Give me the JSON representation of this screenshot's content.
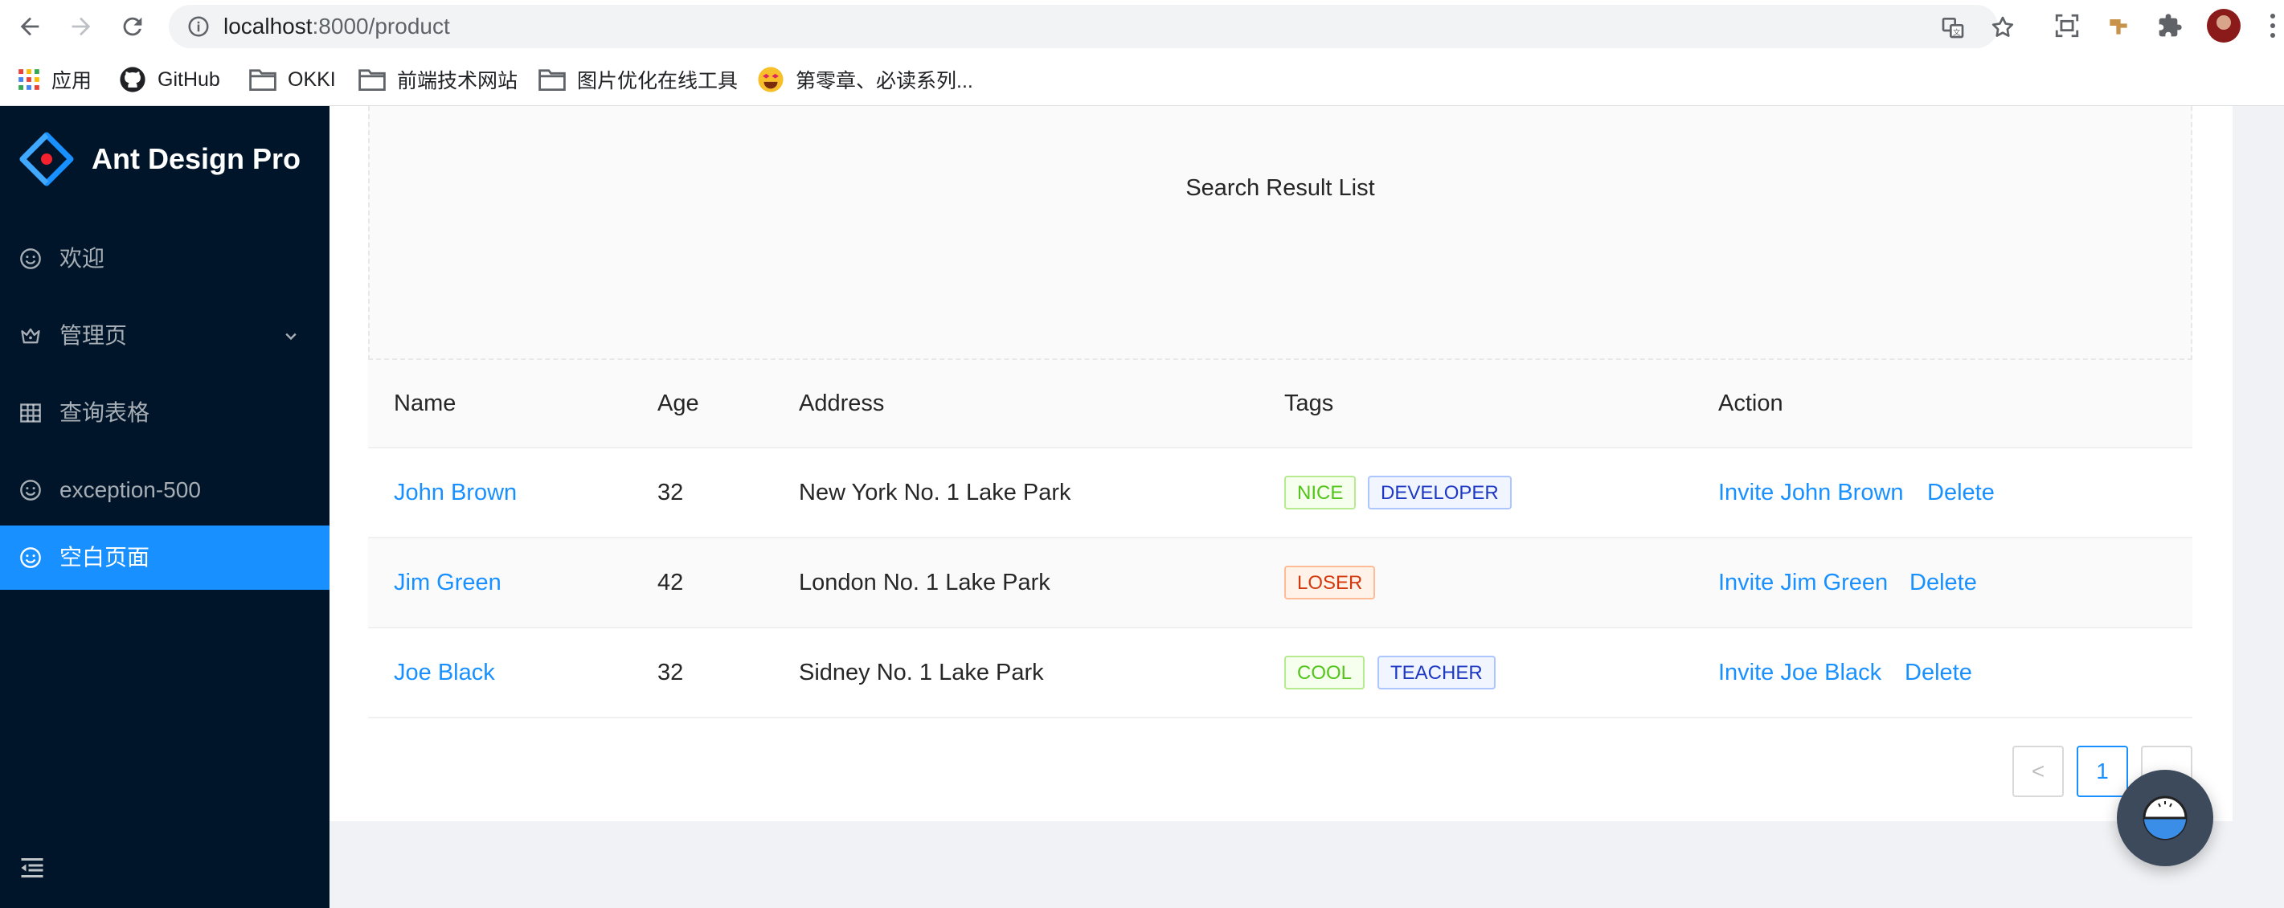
{
  "browser": {
    "url_host": "localhost",
    "url_path": ":8000/product",
    "bookmarks": [
      {
        "label": "应用",
        "icon": "apps-grid-icon"
      },
      {
        "label": "GitHub",
        "icon": "github-icon"
      },
      {
        "label": "OKKI",
        "icon": "folder-icon"
      },
      {
        "label": "前端技术网站",
        "icon": "folder-icon"
      },
      {
        "label": "图片优化在线工具",
        "icon": "folder-icon"
      },
      {
        "label": "第零章、必读系列...",
        "icon": "emoji-icon"
      }
    ]
  },
  "sider": {
    "title": "Ant Design Pro",
    "items": [
      {
        "label": "欢迎",
        "icon": "smile-icon"
      },
      {
        "label": "管理页",
        "icon": "crown-icon",
        "has_submenu": true
      },
      {
        "label": "查询表格",
        "icon": "table-icon"
      },
      {
        "label": "exception-500",
        "icon": "smile-icon"
      },
      {
        "label": "空白页面",
        "icon": "smile-icon",
        "active": true
      }
    ]
  },
  "search": {
    "placeholder_text": "Search Result List"
  },
  "table": {
    "columns": [
      "Name",
      "Age",
      "Address",
      "Tags",
      "Action"
    ],
    "rows": [
      {
        "name": "John Brown",
        "age": "32",
        "address": "New York No. 1 Lake Park",
        "tags": [
          {
            "label": "NICE",
            "color": "green"
          },
          {
            "label": "DEVELOPER",
            "color": "geekblue"
          }
        ],
        "invite": "Invite John Brown",
        "delete": "Delete"
      },
      {
        "name": "Jim Green",
        "age": "42",
        "address": "London No. 1 Lake Park",
        "tags": [
          {
            "label": "LOSER",
            "color": "volcano"
          }
        ],
        "invite": "Invite Jim Green",
        "delete": "Delete"
      },
      {
        "name": "Joe Black",
        "age": "32",
        "address": "Sidney No. 1 Lake Park",
        "tags": [
          {
            "label": "COOL",
            "color": "green"
          },
          {
            "label": "TEACHER",
            "color": "geekblue"
          }
        ],
        "invite": "Invite Joe Black",
        "delete": "Delete"
      }
    ]
  },
  "pagination": {
    "prev": "<",
    "current": "1"
  },
  "colors": {
    "primary": "#1890ff",
    "sider_bg": "#001529"
  }
}
